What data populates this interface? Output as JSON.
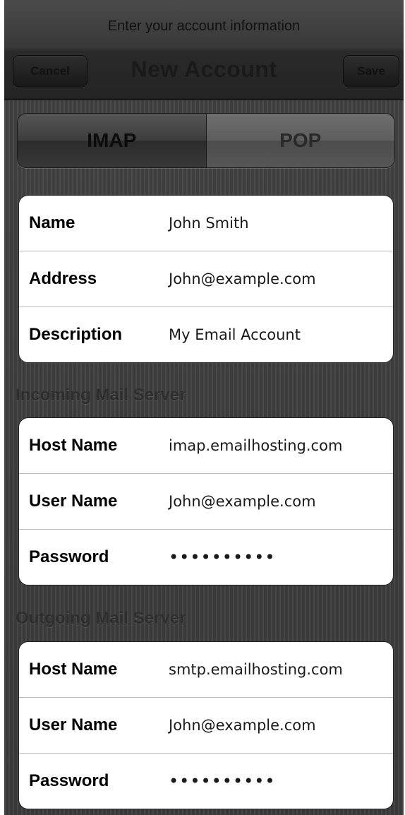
{
  "header": {
    "prompt": "Enter your account information",
    "title": "New Account",
    "cancel_label": "Cancel",
    "save_label": "Save"
  },
  "segments": {
    "imap_label": "IMAP",
    "pop_label": "POP",
    "selected": "IMAP"
  },
  "account": {
    "rows": [
      {
        "label": "Name",
        "value": "John Smith"
      },
      {
        "label": "Address",
        "value": "John@example.com"
      },
      {
        "label": "Description",
        "value": "My Email Account"
      }
    ]
  },
  "incoming": {
    "header": "Incoming Mail Server",
    "rows": [
      {
        "label": "Host Name",
        "value": "imap.emailhosting.com"
      },
      {
        "label": "User Name",
        "value": "John@example.com"
      },
      {
        "label": "Password",
        "value": "••••••••••"
      }
    ]
  },
  "outgoing": {
    "header": "Outgoing Mail Server",
    "rows": [
      {
        "label": "Host Name",
        "value": "smtp.emailhosting.com"
      },
      {
        "label": "User Name",
        "value": "John@example.com"
      },
      {
        "label": "Password",
        "value": "••••••••••"
      }
    ]
  }
}
